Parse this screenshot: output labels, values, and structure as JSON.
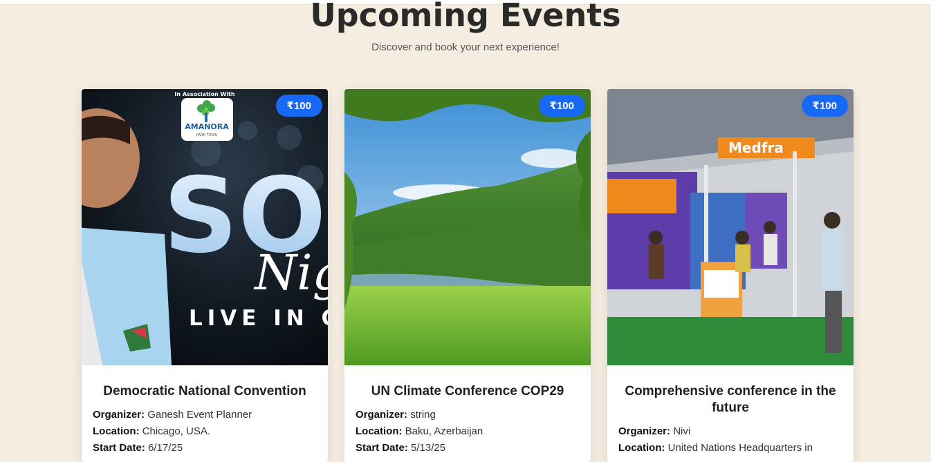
{
  "header": {
    "title": "Upcoming Events",
    "subtitle": "Discover and book your next experience!"
  },
  "labels": {
    "organizer": "Organizer:",
    "location": "Location:",
    "start_date": "Start Date:"
  },
  "colors": {
    "background": "#f5ede0",
    "badge": "#1769f5"
  },
  "events": [
    {
      "title": "Democratic National Convention",
      "price": "₹100",
      "organizer": "Ganesh Event Planner",
      "location": "Chicago, USA.",
      "start_date": "6/17/25",
      "image": {
        "association": "In Association With",
        "brand": "AMANORA",
        "brand_sub": "PARK TOWN",
        "big_letters": "SO",
        "script": "Nig",
        "tagline": "LIVE IN C"
      }
    },
    {
      "title": "UN Climate Conference COP29",
      "price": "₹100",
      "organizer": "string",
      "location": "Baku, Azerbaijan",
      "start_date": "5/13/25"
    },
    {
      "title": "Comprehensive conference in the future",
      "price": "₹100",
      "organizer": "Nivi",
      "location": "United Nations Headquarters in",
      "image": {
        "signage": "Medfra"
      }
    }
  ]
}
